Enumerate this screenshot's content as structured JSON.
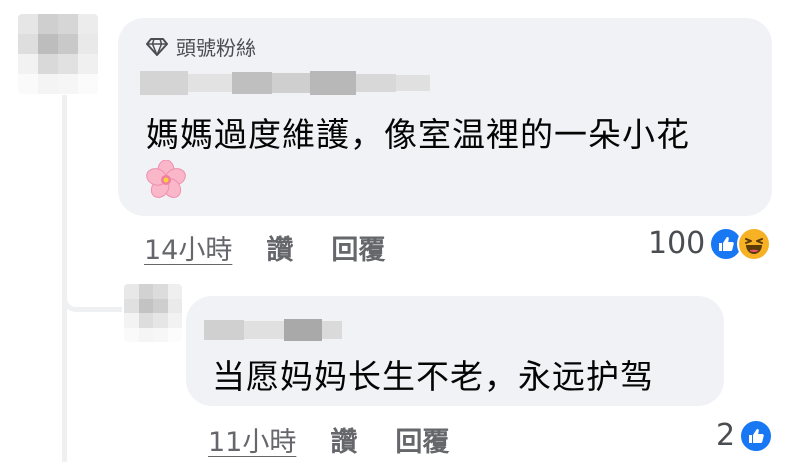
{
  "colors": {
    "bubble": "#f0f2f5",
    "like_blue": "#1877f2",
    "haha_yellow": "#f7b125",
    "meta_text": "#65676b"
  },
  "main_comment": {
    "badge_icon": "diamond-icon",
    "badge": "頭號粉絲",
    "text": "媽媽過度維護，像室温裡的一朵小花",
    "emoji": "cherry-blossom-icon",
    "time": "14小時",
    "like_label": "讚",
    "reply_label": "回覆",
    "reaction_count": "100",
    "reactions": [
      "like-icon",
      "haha-icon"
    ]
  },
  "reply_comment": {
    "text": "当愿妈妈长生不老，永远护驾",
    "time": "11小時",
    "like_label": "讚",
    "reply_label": "回覆",
    "reaction_count": "2",
    "reactions": [
      "like-icon"
    ]
  }
}
